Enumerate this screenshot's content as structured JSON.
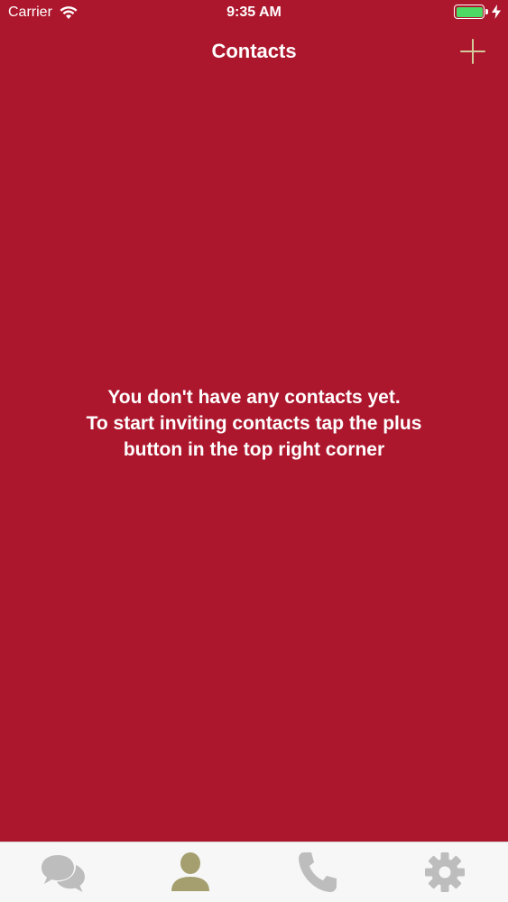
{
  "status_bar": {
    "carrier": "Carrier",
    "time": "9:35 AM",
    "battery_color": "#4cd964"
  },
  "nav": {
    "title": "Contacts",
    "add_icon": "plus-icon"
  },
  "empty_state": {
    "line1": "You don't have any contacts yet.",
    "line2": "To start inviting contacts tap the plus",
    "line3": "button in the top right corner"
  },
  "tab_bar": {
    "items": [
      {
        "icon": "chat-bubbles-icon",
        "active": false
      },
      {
        "icon": "person-icon",
        "active": true
      },
      {
        "icon": "phone-icon",
        "active": false
      },
      {
        "icon": "gear-icon",
        "active": false
      }
    ],
    "active_color": "#a59f70",
    "inactive_color": "#bdbdbd"
  },
  "colors": {
    "background": "#ad172d",
    "accent": "#d4c99b"
  }
}
